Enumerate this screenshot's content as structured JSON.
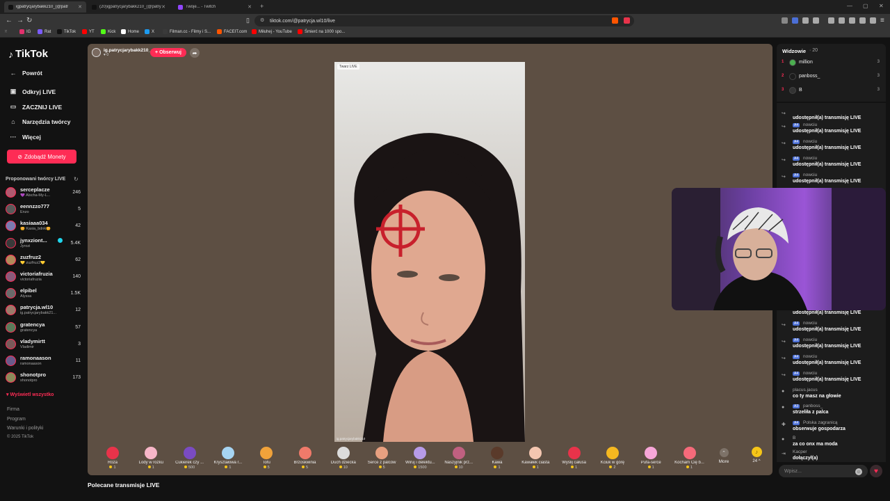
{
  "browser": {
    "tabs": [
      {
        "title": "igpatrycjarybakk210_(@patr",
        "active": true,
        "icon_color": "#111111"
      },
      {
        "title": "(20)igpatrycjarybakk210_(@patrycja",
        "active": false,
        "icon_color": "#111111"
      },
      {
        "title": "Twoje... - Twitch",
        "active": false,
        "icon_color": "#9146ff"
      }
    ],
    "url": "tiktok.com/@patrycja.wl10/live",
    "bookmarks": [
      {
        "label": "IG",
        "color": "#e1306c"
      },
      {
        "label": "Rat",
        "color": "#7b5cff"
      },
      {
        "label": "TikTok",
        "color": "#111111"
      },
      {
        "label": "YT",
        "color": "#ff0000"
      },
      {
        "label": "Kick",
        "color": "#53fc18"
      },
      {
        "label": "Home",
        "color": "#ffffff"
      },
      {
        "label": "X",
        "color": "#1d9bf0"
      },
      {
        "label": "Filman.cc - Filmy i S...",
        "color": "#3a3a3a"
      },
      {
        "label": "FACEIT.com",
        "color": "#ff5500"
      },
      {
        "label": "Miłuhej - YouTube",
        "color": "#ff0000"
      },
      {
        "label": "Śmierć na 1000 spo...",
        "color": "#ff0000"
      }
    ]
  },
  "sidebar": {
    "logo": "TikTok",
    "nav": [
      {
        "label": "Powrót",
        "icon": "arrow-left-icon",
        "glyph": "←"
      },
      {
        "label": "Odkryj LIVE",
        "icon": "live-tv-icon",
        "glyph": "▣"
      },
      {
        "label": "ZACZNIJ LIVE",
        "icon": "video-camera-icon",
        "glyph": "▭"
      },
      {
        "label": "Narzędzia twórcy",
        "icon": "house-icon",
        "glyph": "⌂"
      },
      {
        "label": "Więcej",
        "icon": "more-dots-icon",
        "glyph": "···"
      }
    ],
    "coins_button": "Zdobądź Monety",
    "suggested_title": "Proponowani twórcy LIVE",
    "suggested": [
      {
        "name": "serceplacze",
        "sub": "💜 Alscha-My-L...",
        "count": "246",
        "verified": false
      },
      {
        "name": "eennzzo777",
        "sub": "Enzo",
        "count": "5",
        "verified": false
      },
      {
        "name": "kasiaaa034",
        "sub": "🌼 Kasia_bdnk🌼",
        "count": "42",
        "verified": false
      },
      {
        "name": "jynxziont...",
        "sub": "Jyrozi",
        "count": "5.4K",
        "verified": true
      },
      {
        "name": "zuzfruz2",
        "sub": "💛 zuzfruz2💛",
        "count": "62",
        "verified": false
      },
      {
        "name": "victoriafruzia",
        "sub": "victoriafruzia",
        "count": "140",
        "verified": false
      },
      {
        "name": "elpibel",
        "sub": "Alyssa",
        "count": "1.5K",
        "verified": false
      },
      {
        "name": "patrycja.wl10",
        "sub": "ig.patrycjarybakk21...",
        "count": "12",
        "verified": false
      },
      {
        "name": "gratencya",
        "sub": "gratencya",
        "count": "57",
        "verified": false
      },
      {
        "name": "vladymirtt",
        "sub": "Vladimir",
        "count": "3",
        "verified": false
      },
      {
        "name": "ramonaason",
        "sub": "ramonaason",
        "count": "11",
        "verified": false
      },
      {
        "name": "shonotpro",
        "sub": "shonotpro",
        "count": "173",
        "verified": false
      }
    ],
    "see_all": "Wyświetl wszystko",
    "footer": [
      "Firma",
      "Program",
      "Warunki i polityki",
      "© 2025 TikTok"
    ]
  },
  "stream": {
    "host_name": "ig.patrycjarybakk210_",
    "host_likes": "0",
    "follow_label": "+ Obserwuj",
    "live_tag": "Twarz LIVE",
    "video_caption": "ig.patrycjarybakk210",
    "gifts": [
      {
        "name": "Róża",
        "price": "1",
        "color": "#e8334a"
      },
      {
        "name": "Lody w rożku",
        "price": "1",
        "color": "#f7b6c8"
      },
      {
        "name": "Cukierek czy ...",
        "price": "500",
        "color": "#7a4bc2"
      },
      {
        "name": "Kryształowa r...",
        "price": "1",
        "color": "#a6d4f2"
      },
      {
        "name": "Tofu",
        "price": "5",
        "color": "#f0a23a"
      },
      {
        "name": "Brzoskwinia",
        "price": "5",
        "color": "#f07a6a"
      },
      {
        "name": "Duch dziecka",
        "price": "10",
        "color": "#dcdcdc"
      },
      {
        "name": "Serce z palców",
        "price": "5",
        "color": "#e8a080"
      },
      {
        "name": "Wiruj i delektu...",
        "price": "1500",
        "color": "#b79be8"
      },
      {
        "name": "Naszyjnik prz...",
        "price": "10",
        "color": "#c06080"
      },
      {
        "name": "Kawa",
        "price": "1",
        "color": "#5a3a2a"
      },
      {
        "name": "Kawałek ciasta",
        "price": "1",
        "color": "#f4c6b0"
      },
      {
        "name": "Wyślij całusa",
        "price": "1",
        "color": "#e8334a"
      },
      {
        "name": "Kciuk w górę",
        "price": "2",
        "color": "#f5b820"
      },
      {
        "name": "Pufa-serce",
        "price": "1",
        "color": "#f7a6d8"
      },
      {
        "name": "Kocham Cię b...",
        "price": "1",
        "color": "#f56a7a"
      }
    ],
    "more_label": "More",
    "coin_balance": "24"
  },
  "recommended_title": "Polecane transmisje LIVE",
  "viewers": {
    "title": "Widzowie",
    "count": "· 20",
    "list": [
      {
        "rank": "1",
        "name": "million",
        "score": "3",
        "color": "#4caf50"
      },
      {
        "rank": "2",
        "name": "panboss_",
        "score": "3",
        "color": "#1c1c1c"
      },
      {
        "rank": "3",
        "name": "B",
        "score": "3",
        "color": "#333333"
      }
    ]
  },
  "chat": {
    "messages": [
      {
        "user": "",
        "level": "",
        "text": "udostępnił(a) transmisję LIVE",
        "icon": "share-icon",
        "glyph": "↪"
      },
      {
        "user": "nowciu",
        "level": "A4",
        "text": "udostępnił(a) transmisję LIVE",
        "icon": "share-icon",
        "glyph": "↪"
      },
      {
        "user": "nowciu",
        "level": "A4",
        "text": "udostępnił(a) transmisję LIVE",
        "icon": "share-icon",
        "glyph": "↪"
      },
      {
        "user": "nowciu",
        "level": "A4",
        "text": "udostępnił(a) transmisję LIVE",
        "icon": "share-icon",
        "glyph": "↪"
      },
      {
        "user": "nowciu",
        "level": "A4",
        "text": "udostępnił(a) transmisję LIVE",
        "icon": "share-icon",
        "glyph": "↪"
      },
      {
        "user": "nowciu",
        "level": "A4",
        "text": "udostępnił(a) transmisję LIVE",
        "icon": "share-icon",
        "glyph": "↪"
      },
      {
        "user": "nowciu",
        "level": "A4",
        "text": "udostępnił(a) transmisję LIVE",
        "icon": "share-icon",
        "glyph": "↪"
      },
      {
        "user": "nowciu",
        "level": "A4",
        "text": "udostępnił(a) transmisję LIVE",
        "icon": "share-icon",
        "glyph": "↪"
      },
      {
        "user": "nowciu",
        "level": "A4",
        "text": "udostępnił(a) transmisję LIVE",
        "icon": "share-icon",
        "glyph": "↪"
      },
      {
        "user": "nowciu",
        "level": "A4",
        "text": "udostępnił(a) transmisję LIVE",
        "icon": "share-icon",
        "glyph": "↪"
      },
      {
        "user": "placus.jacus",
        "level": "",
        "text": "co ty masz na głowie",
        "icon": "avatar-icon",
        "glyph": "●"
      },
      {
        "user": "panboss_",
        "level": "A3",
        "text": "strzeliła z palca",
        "icon": "avatar-icon",
        "glyph": "●"
      },
      {
        "user": "Polska zagranicą",
        "level": "A4",
        "text": "obserwuje gospodarza",
        "icon": "user-follow-icon",
        "glyph": "✚"
      },
      {
        "user": "B",
        "level": "",
        "text": "za co onx ma moda",
        "icon": "avatar-icon",
        "glyph": "●"
      },
      {
        "user": "Kacper",
        "level": "",
        "text": "dołączył(a)",
        "icon": "join-icon",
        "glyph": "⇥"
      }
    ],
    "input_placeholder": "Wpisz..."
  }
}
